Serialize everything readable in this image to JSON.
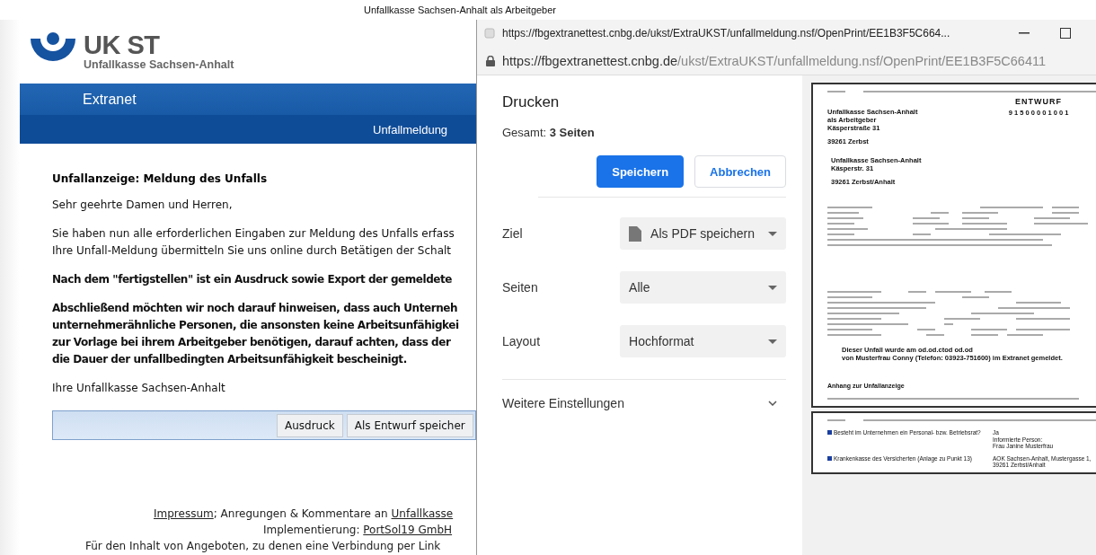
{
  "page_title": "Unfallkasse Sachsen-Anhalt als Arbeitgeber",
  "site": {
    "logo_text": "UK ST",
    "logo_subtitle": "Unfallkasse Sachsen-Anhalt",
    "banner": "Extranet",
    "nav": [
      "Unfallmeldung"
    ]
  },
  "content": {
    "heading": "Unfallanzeige: Meldung des Unfalls",
    "paragraphs": [
      {
        "bold": false,
        "lines": [
          "Sehr geehrte Damen und Herren,"
        ]
      },
      {
        "bold": false,
        "lines": [
          "Sie haben nun alle erforderlichen Eingaben zur Meldung des Unfalls erfass",
          "Ihre Unfall-Meldung übermitteln Sie uns online durch Betätigen der Schalt"
        ]
      },
      {
        "bold": true,
        "lines": [
          "Nach dem \"fertigstellen\" ist ein Ausdruck sowie Export der gemeldete"
        ]
      },
      {
        "bold": true,
        "lines": [
          "Abschließend möchten wir noch darauf hinweisen, dass auch Unterneh",
          "unternehmerähnliche Personen, die ansonsten keine Arbeitsunfähigkei",
          "zur Vorlage bei ihrem Arbeitgeber benötigen, darauf achten, dass der",
          "die Dauer der unfallbedingten Arbeitsunfähigkeit bescheinigt."
        ]
      },
      {
        "bold": false,
        "lines": [
          "Ihre Unfallkasse Sachsen-Anhalt"
        ]
      }
    ],
    "buttons": [
      "Ausdruck",
      "Als Entwurf speicher"
    ]
  },
  "footer": [
    [
      {
        "text": "Impressum",
        "link": true
      },
      {
        "text": "; Anregungen & Kommentare an ",
        "link": false
      },
      {
        "text": "Unfallkasse",
        "link": true
      }
    ],
    [
      {
        "text": "Implementierung: ",
        "link": false
      },
      {
        "text": "PortSol19 GmbH",
        "link": true
      }
    ],
    [
      {
        "text": "Für den Inhalt von Angeboten, zu denen eine Verbindung per Link",
        "link": false
      }
    ]
  ],
  "popup": {
    "title": "https://fbgextranettest.cnbg.de/ukst/ExtraUKST/unfallmeldung.nsf/OpenPrint/EE1B3F5C664...",
    "address": {
      "host": "https://fbgextranettest.cnbg.de",
      "path": "/ukst/ExtraUKST/unfallmeldung.nsf/OpenPrint/EE1B3F5C66411"
    },
    "print": {
      "title": "Drucken",
      "total": "Gesamt: **3 Seiten**",
      "buttons": [
        {
          "label": "Speichern",
          "kind": "primary"
        },
        {
          "label": "Abbrechen",
          "kind": "secondary"
        }
      ],
      "settings": [
        {
          "label": "Ziel",
          "value": "Als PDF speichern",
          "kind": "destination"
        },
        {
          "label": "Seiten",
          "value": "Alle",
          "kind": "select"
        },
        {
          "label": "Layout",
          "value": "Hochformat",
          "kind": "select"
        }
      ],
      "more": "Weitere Einstellungen"
    },
    "preview": {
      "page1": {
        "stamp": "ENTWURF",
        "number": "9 1 5 0 0 0 0 1 0 0 1",
        "employer": [
          "Unfallkasse Sachsen-Anhalt",
          "als Arbeitgeber",
          "Käsperstraße 31"
        ],
        "employer_city": "39261 Zerbst",
        "recipient": [
          "Unfallkasse Sachsen-Anhalt",
          "Käsperstr. 31"
        ],
        "recipient_city": "39261 Zerbst/Anhalt",
        "notice": [
          "Dieser Unfall wurde am od.od.ctod od.od",
          "von Musterfrau Conny (Telefon: 03923-751600) im Extranet gemeldet."
        ],
        "appendix": "Anhang zur Unfallanzeige"
      },
      "page2": {
        "items": [
          {
            "question": "Besteht im Unternehmen ein Personal- bzw. Betriebsrat?",
            "answer": [
              "Ja",
              "Informierte Person:",
              "Frau Janine Musterfrau"
            ]
          },
          {
            "question": "Krankenkasse des Versicherten (Anlage zu Punkt 13)",
            "answer": [
              "AOK Sachsen-Anhalt, Mustergasse 1,",
              "39261 Zerbst/Anhalt"
            ]
          }
        ]
      }
    }
  }
}
